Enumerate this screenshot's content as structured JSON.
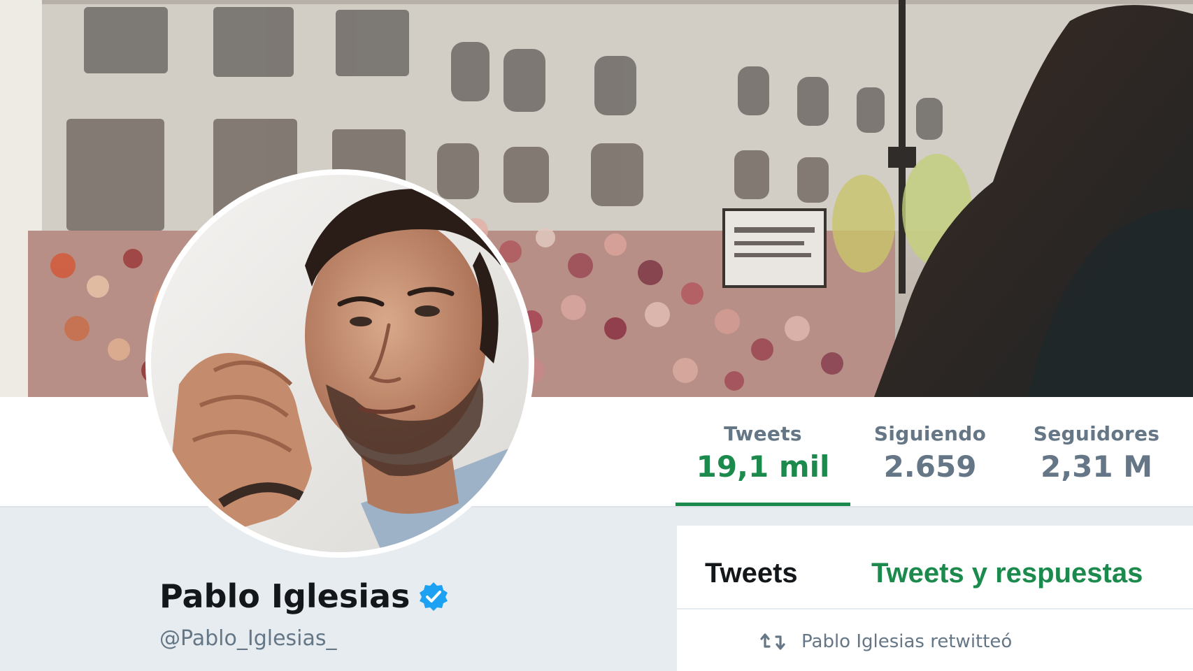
{
  "profile": {
    "name": "Pablo Iglesias",
    "handle": "@Pablo_Iglesias_",
    "verified": true
  },
  "stats": {
    "tweets": {
      "label": "Tweets",
      "value": "19,1 mil"
    },
    "following": {
      "label": "Siguiendo",
      "value": "2.659"
    },
    "followers": {
      "label": "Seguidores",
      "value": "2,31 M"
    }
  },
  "timeline": {
    "tabs": [
      {
        "label": "Tweets"
      },
      {
        "label": "Tweets y respuestas"
      }
    ],
    "retweet_label": "Pablo Iglesias retwitteó"
  },
  "colors": {
    "accent": "#1b8a4c",
    "muted": "#657786",
    "text": "#14171a",
    "verified": "#1da1f2",
    "background": "#e6ecf0"
  },
  "icons": {
    "verified": "verified-badge-icon",
    "retweet": "retweet-icon"
  }
}
